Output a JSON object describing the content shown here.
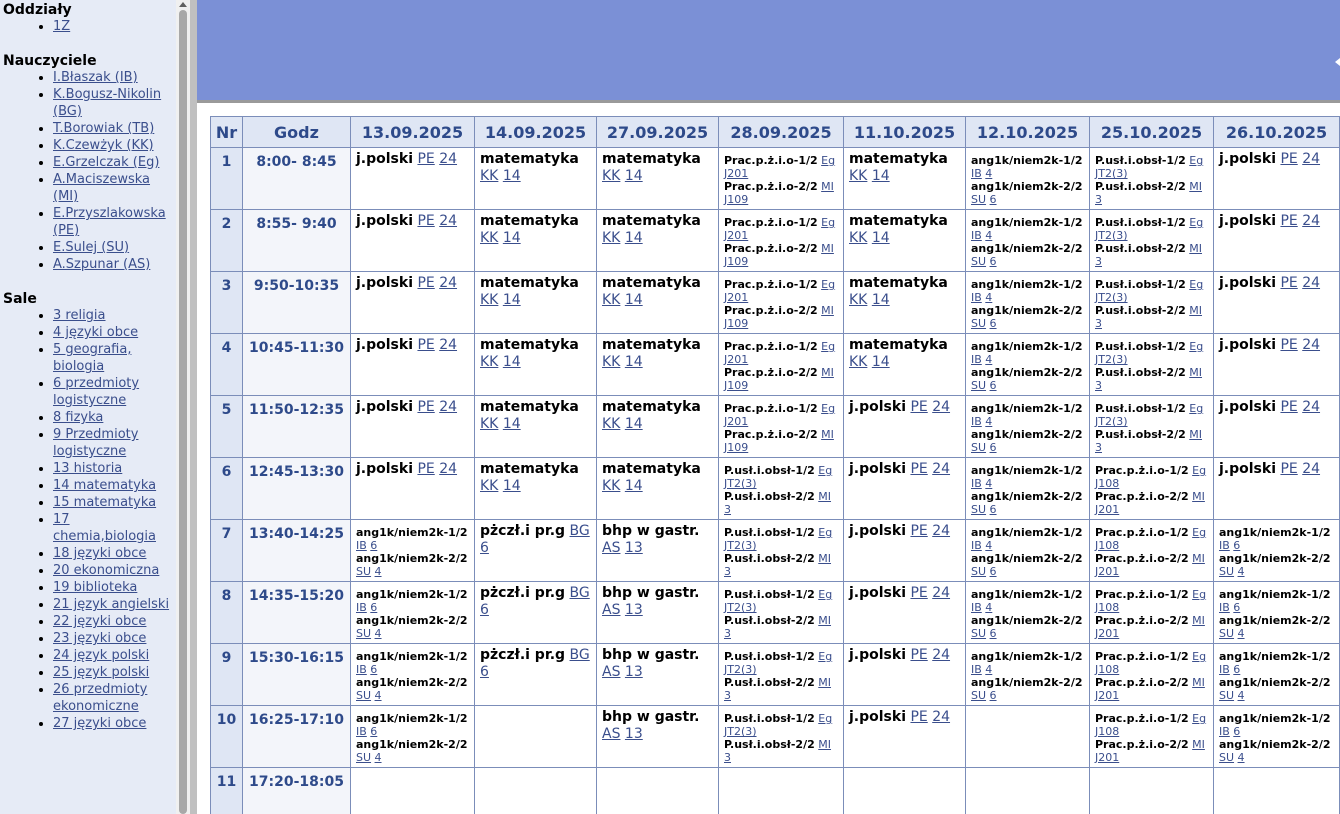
{
  "sidebar": {
    "sections": [
      {
        "title": "Oddziały",
        "items": [
          "1Z"
        ]
      },
      {
        "title": "Nauczyciele",
        "items": [
          "I.Błaszak (IB)",
          "K.Bogusz-Nikolin (BG)",
          "T.Borowiak (TB)",
          "K.Czewżyk (KK)",
          "E.Grzelczak (Eg)",
          "A.Maciszewska (MI)",
          "E.Przyszlakowska (PE)",
          "E.Sulej (SU)",
          "A.Szpunar (AS)"
        ]
      },
      {
        "title": "Sale",
        "items": [
          "3 religia",
          "4 języki obce",
          "5 geografia, biologia",
          "6 przedmioty logistyczne",
          "8 fizyka",
          "9 Przedmioty logistyczne",
          "13 historia",
          "14 matematyka",
          "15 matematyka",
          "17 chemia,biologia",
          "18 języki obce",
          "20 ekonomiczna",
          "19 biblioteka",
          "21 język angielski",
          "22 języki obce",
          "23 języki obce",
          "24 język polski",
          "25 język polski",
          "26 przedmioty ekonomiczne",
          "27 języki obce"
        ]
      }
    ]
  },
  "header_nr": "Nr",
  "header_godz": "Godz",
  "dates": [
    "13.09.2025",
    "14.09.2025",
    "27.09.2025",
    "28.09.2025",
    "11.10.2025",
    "12.10.2025",
    "25.10.2025",
    "26.10.2025"
  ],
  "rows": [
    {
      "nr": "1",
      "time": "8:00- 8:45"
    },
    {
      "nr": "2",
      "time": "8:55- 9:40"
    },
    {
      "nr": "3",
      "time": "9:50-10:35"
    },
    {
      "nr": "4",
      "time": "10:45-11:30"
    },
    {
      "nr": "5",
      "time": "11:50-12:35"
    },
    {
      "nr": "6",
      "time": "12:45-13:30"
    },
    {
      "nr": "7",
      "time": "13:40-14:25"
    },
    {
      "nr": "8",
      "time": "14:35-15:20"
    },
    {
      "nr": "9",
      "time": "15:30-16:15"
    },
    {
      "nr": "10",
      "time": "16:25-17:10"
    },
    {
      "nr": "11",
      "time": "17:20-18:05"
    }
  ],
  "lessons": {
    "jpol": {
      "subject": "j.polski",
      "teacher": "PE",
      "room": "24"
    },
    "mat": {
      "subject": "matematyka",
      "teacher": "KK",
      "room": "14"
    },
    "pszcz": {
      "subject": "pżczł.i pr.g",
      "teacher": "BG",
      "room": "6"
    },
    "bhp": {
      "subject": "bhp w gastr.",
      "teacher": "AS",
      "room": "13"
    }
  },
  "groups": {
    "prac28": [
      {
        "subject": "Prac.p.ż.i.o-1/2",
        "teacher": "Eg",
        "room": "J201"
      },
      {
        "subject": "Prac.p.ż.i.o-2/2",
        "teacher": "MI",
        "room": "J109"
      }
    ],
    "pusl28": [
      {
        "subject": "P.usł.i.obsł-1/2",
        "teacher": "Eg",
        "room": "JT2(3)"
      },
      {
        "subject": "P.usł.i.obsł-2/2",
        "teacher": "MI",
        "room": "3"
      }
    ],
    "ang12": [
      {
        "subject": "ang1k/niem2k-1/2",
        "teacher": "IB",
        "room": "4"
      },
      {
        "subject": "ang1k/niem2k-2/2",
        "teacher": "SU",
        "room": "6"
      }
    ],
    "ang13": [
      {
        "subject": "ang1k/niem2k-1/2",
        "teacher": "IB",
        "room": "6"
      },
      {
        "subject": "ang1k/niem2k-2/2",
        "teacher": "SU",
        "room": "4"
      }
    ],
    "prac25": [
      {
        "subject": "Prac.p.ż.i.o-1/2",
        "teacher": "Eg",
        "room": "J108"
      },
      {
        "subject": "Prac.p.ż.i.o-2/2",
        "teacher": "MI",
        "room": "J201"
      }
    ]
  }
}
